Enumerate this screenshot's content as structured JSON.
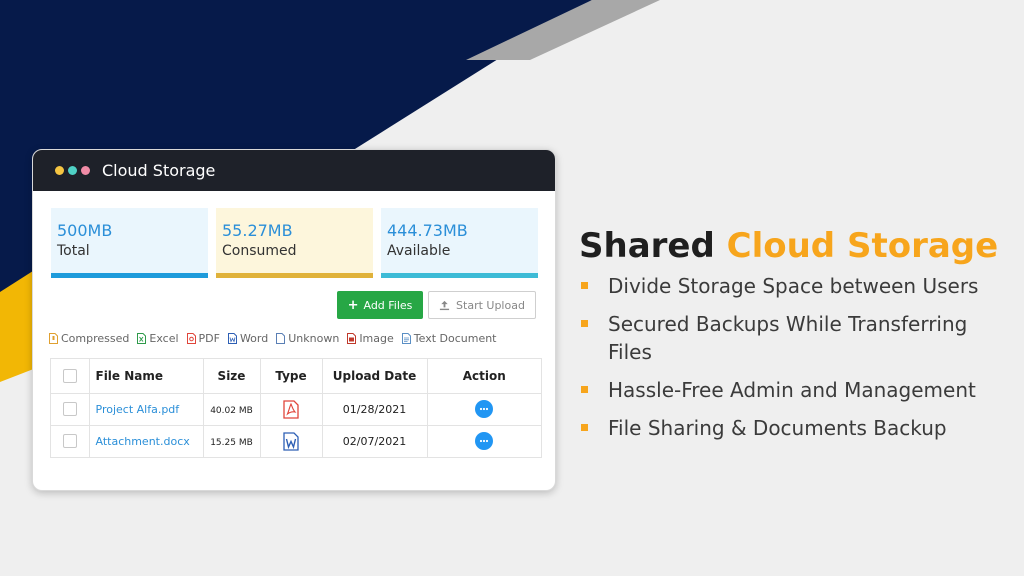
{
  "colors": {
    "navy": "#061a4a",
    "yellow": "#f2b705",
    "gray_stripe": "#a8a8a8",
    "accent_orange": "#f7a51c",
    "link_blue": "#2b8fd8",
    "green": "#27a745"
  },
  "card": {
    "title": "Cloud Storage",
    "window_dots": [
      "#f5c542",
      "#4fd1c5",
      "#f08ba6"
    ]
  },
  "stats": [
    {
      "value": "500MB",
      "label": "Total",
      "bg": "#eaf6fd",
      "bar": "#1e9bdb"
    },
    {
      "value": "55.27MB",
      "label": "Consumed",
      "bg": "#fdf6dc",
      "bar": "#e0b23a"
    },
    {
      "value": "444.73MB",
      "label": "Available",
      "bg": "#eaf6fd",
      "bar": "#3dbbd6"
    }
  ],
  "buttons": {
    "add_files": "Add Files",
    "start_upload": "Start Upload"
  },
  "legend": [
    {
      "label": "Compressed",
      "icon": "zip-file-icon",
      "color": "#e0a030"
    },
    {
      "label": "Excel",
      "icon": "excel-file-icon",
      "color": "#2e9a4a"
    },
    {
      "label": "PDF",
      "icon": "pdf-file-icon",
      "color": "#e0453a"
    },
    {
      "label": "Word",
      "icon": "word-file-icon",
      "color": "#2d5fb5"
    },
    {
      "label": "Unknown",
      "icon": "unknown-file-icon",
      "color": "#5a7fb5"
    },
    {
      "label": "Image",
      "icon": "image-file-icon",
      "color": "#c0392b"
    },
    {
      "label": "Text Document",
      "icon": "text-file-icon",
      "color": "#5a8fc5"
    }
  ],
  "table": {
    "headers": [
      "File Name",
      "Size",
      "Type",
      "Upload Date",
      "Action"
    ],
    "rows": [
      {
        "name": "Project Alfa.pdf",
        "size": "40.02 MB",
        "type": "pdf-file-icon",
        "date": "01/28/2021"
      },
      {
        "name": "Attachment.docx",
        "size": "15.25 MB",
        "type": "word-file-icon",
        "date": "02/07/2021"
      }
    ]
  },
  "headline": {
    "part1": "Shared ",
    "part2": "Cloud Storage"
  },
  "bullets": [
    "Divide Storage Space between Users",
    "Secured Backups While Transferring Files",
    "Hassle-Free Admin and Management",
    "File Sharing & Documents Backup"
  ]
}
